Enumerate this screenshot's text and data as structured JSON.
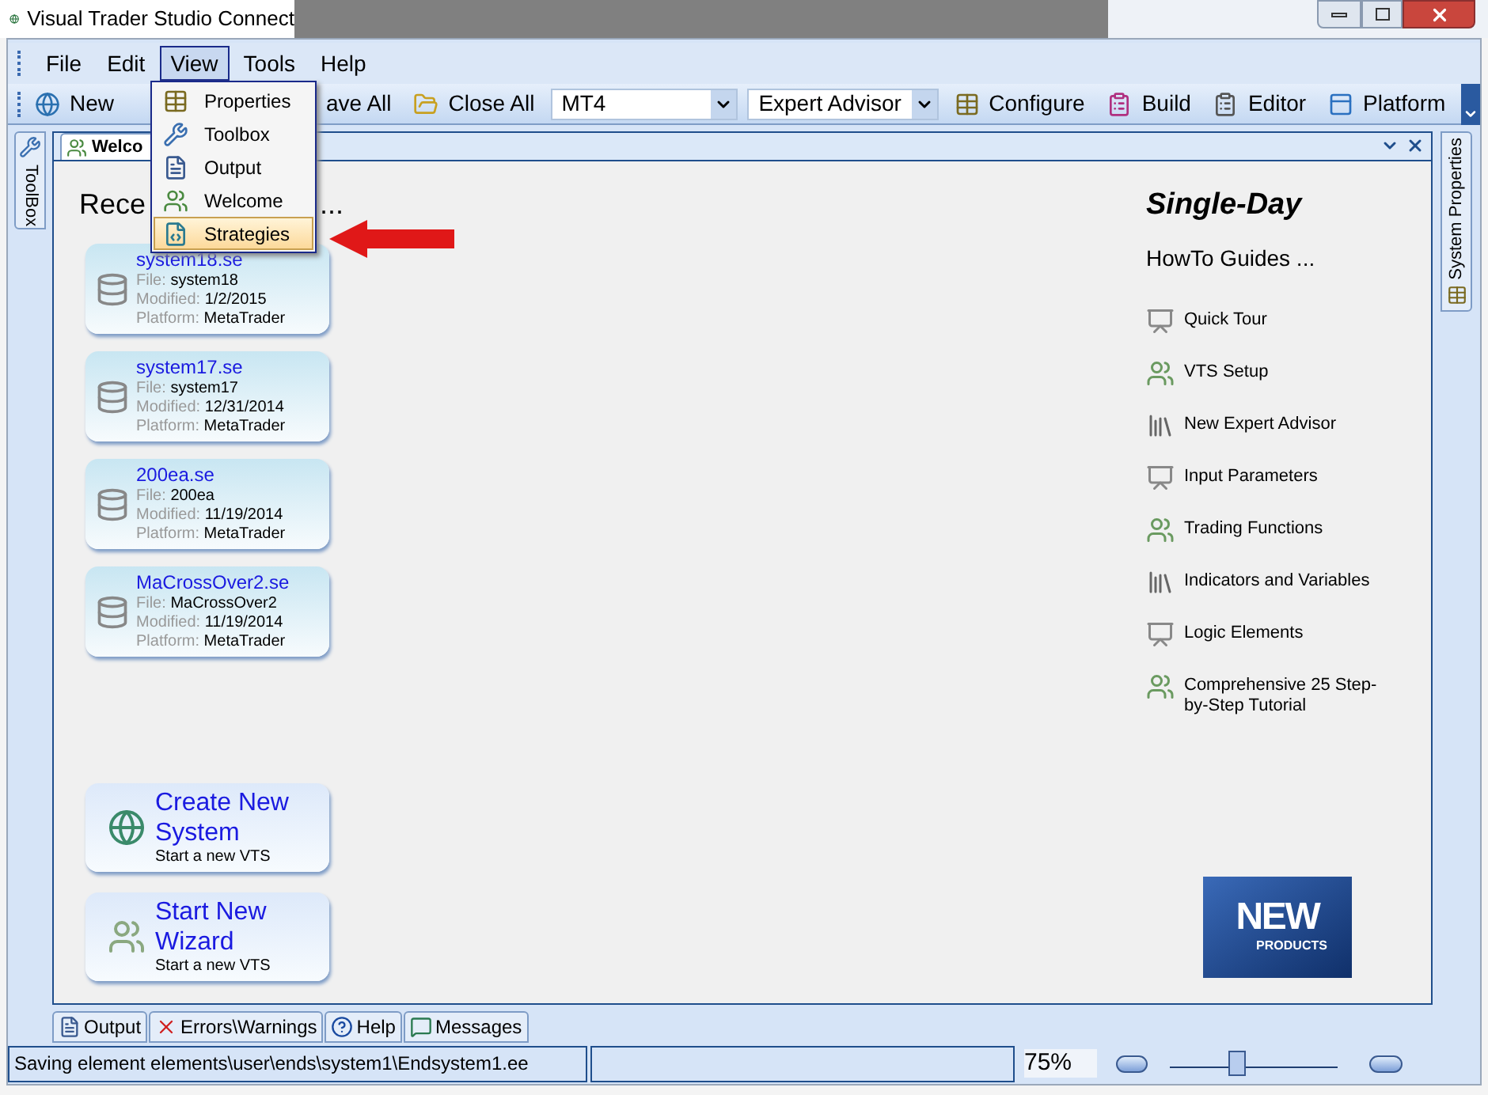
{
  "window": {
    "title": "Visual Trader Studio Connect"
  },
  "menu": [
    {
      "label": "File",
      "selected": false
    },
    {
      "label": "Edit",
      "selected": false
    },
    {
      "label": "View",
      "selected": true
    },
    {
      "label": "Tools",
      "selected": false
    },
    {
      "label": "Help",
      "selected": false
    }
  ],
  "view_menu": [
    {
      "label": "Properties",
      "kind": "properties",
      "selected": false
    },
    {
      "label": "Toolbox",
      "kind": "toolbox",
      "selected": false
    },
    {
      "label": "Output",
      "kind": "output",
      "selected": false
    },
    {
      "label": "Welcome",
      "kind": "welcome",
      "selected": false
    },
    {
      "label": "Strategies",
      "kind": "strategies",
      "selected": true
    }
  ],
  "toolbar": [
    {
      "kind": "globe",
      "label": "New"
    },
    {
      "kind": "hidden",
      "label": "ave All"
    },
    {
      "kind": "folder",
      "label": "Close All"
    },
    {
      "kind": "combo",
      "value": "MT4"
    },
    {
      "kind": "combo",
      "value": "Expert Advisor"
    },
    {
      "kind": "grid",
      "label": "Configure"
    },
    {
      "kind": "build",
      "label": "Build"
    },
    {
      "kind": "clipboard",
      "label": "Editor"
    },
    {
      "kind": "window",
      "label": "Platform"
    }
  ],
  "side_tabs": {
    "left": "ToolBox",
    "right": "System Properties"
  },
  "document_tab": {
    "label": "Welco"
  },
  "recent": {
    "heading": [
      "Rece",
      "..."
    ],
    "systems": [
      {
        "title": "system18.se",
        "file_label": "File:",
        "file": "system18",
        "modified_label": "Modified:",
        "modified": "1/2/2015",
        "platform_label": "Platform:",
        "platform": "MetaTrader"
      },
      {
        "title": "system17.se",
        "file_label": "File:",
        "file": "system17",
        "modified_label": "Modified:",
        "modified": "12/31/2014",
        "platform_label": "Platform:",
        "platform": "MetaTrader"
      },
      {
        "title": "200ea.se",
        "file_label": "File:",
        "file": "200ea",
        "modified_label": "Modified:",
        "modified": "11/19/2014",
        "platform_label": "Platform:",
        "platform": "MetaTrader"
      },
      {
        "title": "MaCrossOver2.se",
        "file_label": "File:",
        "file": "MaCrossOver2",
        "modified_label": "Modified:",
        "modified": "11/19/2014",
        "platform_label": "Platform:",
        "platform": "MetaTrader"
      }
    ]
  },
  "actions": [
    {
      "title": "Create New System",
      "subtitle": "Start a new VTS",
      "kind": "globe"
    },
    {
      "title": "Start New Wizard",
      "subtitle": "Start a new VTS",
      "kind": "people"
    }
  ],
  "guides": {
    "title": "Single-Day",
    "subtitle": "HowTo Guides ...",
    "items": [
      {
        "label": "Quick Tour",
        "kind": "presentation"
      },
      {
        "label": "VTS Setup",
        "kind": "people"
      },
      {
        "label": "New Expert Advisor",
        "kind": "books"
      },
      {
        "label": "Input Parameters",
        "kind": "presentation"
      },
      {
        "label": "Trading Functions",
        "kind": "people"
      },
      {
        "label": "Indicators and Variables",
        "kind": "books"
      },
      {
        "label": "Logic Elements",
        "kind": "presentation"
      },
      {
        "label": "Comprehensive 25 Step-by-Step Tutorial",
        "kind": "people"
      }
    ]
  },
  "promo": {
    "headline": "NEW",
    "caption": "PRODUCTS"
  },
  "bottom_tabs": [
    {
      "label": "Output",
      "kind": "output"
    },
    {
      "label": "Errors\\Warnings",
      "kind": "errors"
    },
    {
      "label": "Help",
      "kind": "help"
    },
    {
      "label": "Messages",
      "kind": "messages"
    }
  ],
  "status_bar": {
    "message": "Saving element elements\\user\\ends\\system1\\Endsystem1.ee",
    "zoom": "75%",
    "level": 0.4
  }
}
